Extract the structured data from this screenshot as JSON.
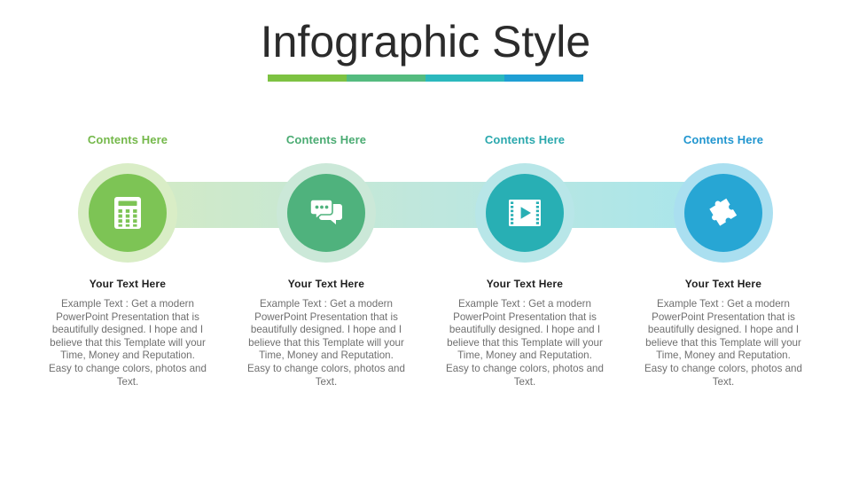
{
  "header": {
    "title": "Infographic Style",
    "rule_colors": [
      "#7dc242",
      "#54bb7f",
      "#2bb8bd",
      "#1f9fd4"
    ]
  },
  "band": {
    "gradient_from": "#d4eac4",
    "gradient_mid": "#bfe7dd",
    "gradient_to": "#a8e5ec"
  },
  "columns": [
    {
      "label": "Contents Here",
      "label_color": "#74b84a",
      "ring_color": "#d9edc6",
      "circle_color": "#7dc455",
      "icon": "calculator-icon",
      "subhead": "Your Text Here",
      "body": "Example Text : Get a modern PowerPoint Presentation that is beautifully designed. I hope and I believe that this Template will your Time, Money and Reputation. Easy to change colors, photos and Text."
    },
    {
      "label": "Contents Here",
      "label_color": "#4aab72",
      "ring_color": "#cbe8d8",
      "circle_color": "#4fb27d",
      "icon": "chat-bubbles-icon",
      "subhead": "Your Text Here",
      "body": "Example Text : Get a modern PowerPoint Presentation that is beautifully designed. I hope and I believe that this Template will your Time, Money and Reputation. Easy to change colors, photos and Text."
    },
    {
      "label": "Contents Here",
      "label_color": "#2aa8ad",
      "ring_color": "#b8e6e8",
      "circle_color": "#28afb4",
      "icon": "film-play-icon",
      "subhead": "Your Text Here",
      "body": "Example Text : Get a modern PowerPoint Presentation that is beautifully designed. I hope and I believe that this Template will your Time, Money and Reputation. Easy to change colors, photos and Text."
    },
    {
      "label": "Contents Here",
      "label_color": "#1f95cf",
      "ring_color": "#aadff0",
      "circle_color": "#27a6d4",
      "icon": "puzzle-piece-icon",
      "subhead": "Your Text Here",
      "body": "Example Text : Get a modern PowerPoint Presentation that is beautifully designed. I hope and I believe that this Template will your Time, Money and Reputation. Easy to change colors, photos and Text."
    }
  ]
}
